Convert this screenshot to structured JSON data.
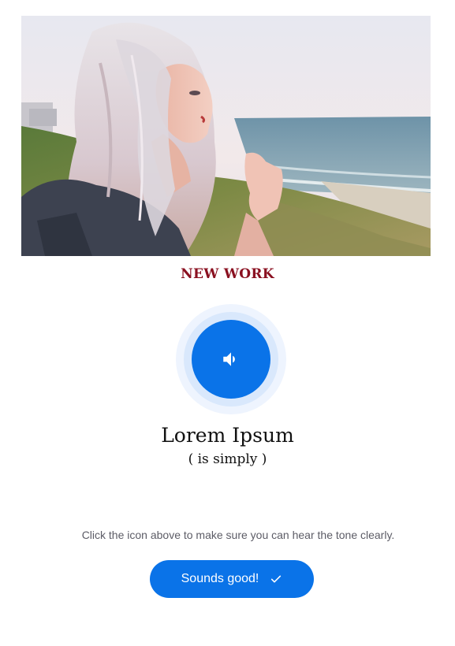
{
  "hero": {
    "image": "photo of a woman with platinum hair by the sea"
  },
  "section_title": "NEW WORK",
  "audio": {
    "icon": "speaker-icon"
  },
  "title": "Lorem Ipsum",
  "subtitle": "( is simply )",
  "instructions": "Click the icon above to make sure you can hear the tone clearly.",
  "confirm_button": {
    "label": "Sounds good!",
    "icon": "check-icon"
  },
  "colors": {
    "accent": "#0a73e8",
    "title_red": "#8a1020",
    "ring_light": "#eef4fe",
    "ring_mid": "#d9e8fc"
  }
}
